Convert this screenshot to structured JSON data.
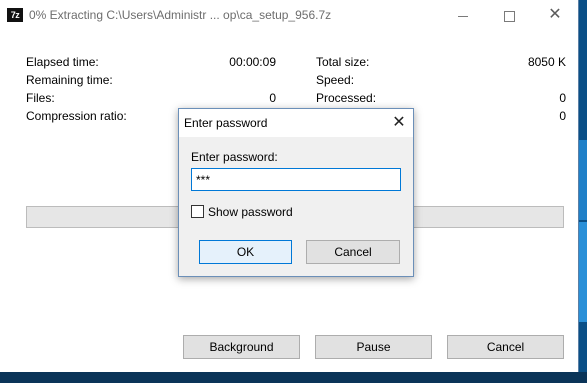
{
  "window": {
    "title": "0% Extracting C:\\Users\\Administr ... op\\ca_setup_956.7z",
    "icon_text": "7z",
    "controls": {
      "minimize": "minimize-icon",
      "maximize": "maximize-icon",
      "close": "✕"
    }
  },
  "stats_left": [
    {
      "label": "Elapsed time:",
      "value": "00:00:09"
    },
    {
      "label": "Remaining time:",
      "value": ""
    },
    {
      "label": "Files:",
      "value": "0"
    },
    {
      "label": "Compression ratio:",
      "value": ""
    }
  ],
  "stats_right": [
    {
      "label": "Total size:",
      "value": "8050 K"
    },
    {
      "label": "Speed:",
      "value": ""
    },
    {
      "label": "Processed:",
      "value": "0"
    },
    {
      "label": "",
      "value": "0"
    }
  ],
  "progress": {
    "percent": 0,
    "fill_color": "#06b025"
  },
  "buttons": {
    "background": "Background",
    "pause": "Pause",
    "cancel": "Cancel"
  },
  "password_dialog": {
    "title": "Enter password",
    "close": "✕",
    "field_label": "Enter password:",
    "field_value": "***",
    "show_password_label": "Show password",
    "show_password_checked": false,
    "ok": "OK",
    "cancel": "Cancel"
  }
}
